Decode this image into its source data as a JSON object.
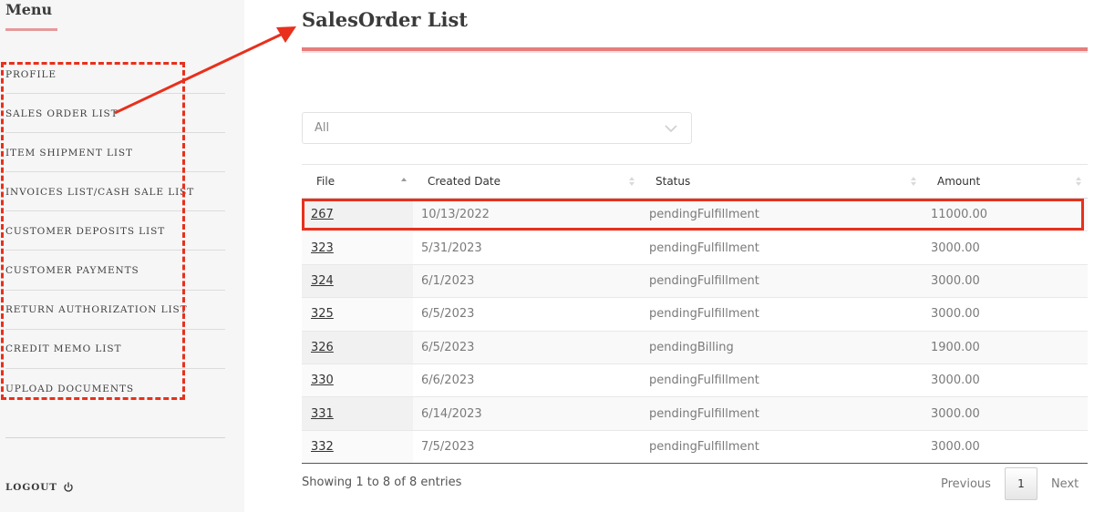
{
  "sidebar": {
    "title": "Menu",
    "items": [
      {
        "label": "PROFILE"
      },
      {
        "label": "SALES ORDER LIST"
      },
      {
        "label": "ITEM SHIPMENT LIST"
      },
      {
        "label": "INVOICES LIST/CASH SALE LIST"
      },
      {
        "label": "CUSTOMER DEPOSITS LIST"
      },
      {
        "label": "CUSTOMER PAYMENTS"
      },
      {
        "label": "RETURN AUTHORIZATION LIST"
      },
      {
        "label": "CREDIT MEMO LIST"
      },
      {
        "label": "UPLOAD DOCUMENTS"
      }
    ],
    "logout_label": "LOGOUT",
    "logout_icon": "power-icon"
  },
  "main": {
    "title": "SalesOrder List",
    "filter": {
      "selected": "All"
    },
    "table": {
      "columns": [
        "File",
        "Created Date",
        "Status",
        "Amount"
      ],
      "rows": [
        {
          "file": "267",
          "created": "10/13/2022",
          "status": "pendingFulfillment",
          "amount": "11000.00"
        },
        {
          "file": "323",
          "created": "5/31/2023",
          "status": "pendingFulfillment",
          "amount": "3000.00"
        },
        {
          "file": "324",
          "created": "6/1/2023",
          "status": "pendingFulfillment",
          "amount": "3000.00"
        },
        {
          "file": "325",
          "created": "6/5/2023",
          "status": "pendingFulfillment",
          "amount": "3000.00"
        },
        {
          "file": "326",
          "created": "6/5/2023",
          "status": "pendingBilling",
          "amount": "1900.00"
        },
        {
          "file": "330",
          "created": "6/6/2023",
          "status": "pendingFulfillment",
          "amount": "3000.00"
        },
        {
          "file": "331",
          "created": "6/14/2023",
          "status": "pendingFulfillment",
          "amount": "3000.00"
        },
        {
          "file": "332",
          "created": "7/5/2023",
          "status": "pendingFulfillment",
          "amount": "3000.00"
        }
      ]
    },
    "info": "Showing 1 to 8 of 8 entries",
    "pagination": {
      "previous": "Previous",
      "current": "1",
      "next": "Next"
    }
  },
  "colors": {
    "annotation": "#e8301c",
    "title_rule": "#e77d7d",
    "sidebar_bg": "#f6f6f6"
  }
}
